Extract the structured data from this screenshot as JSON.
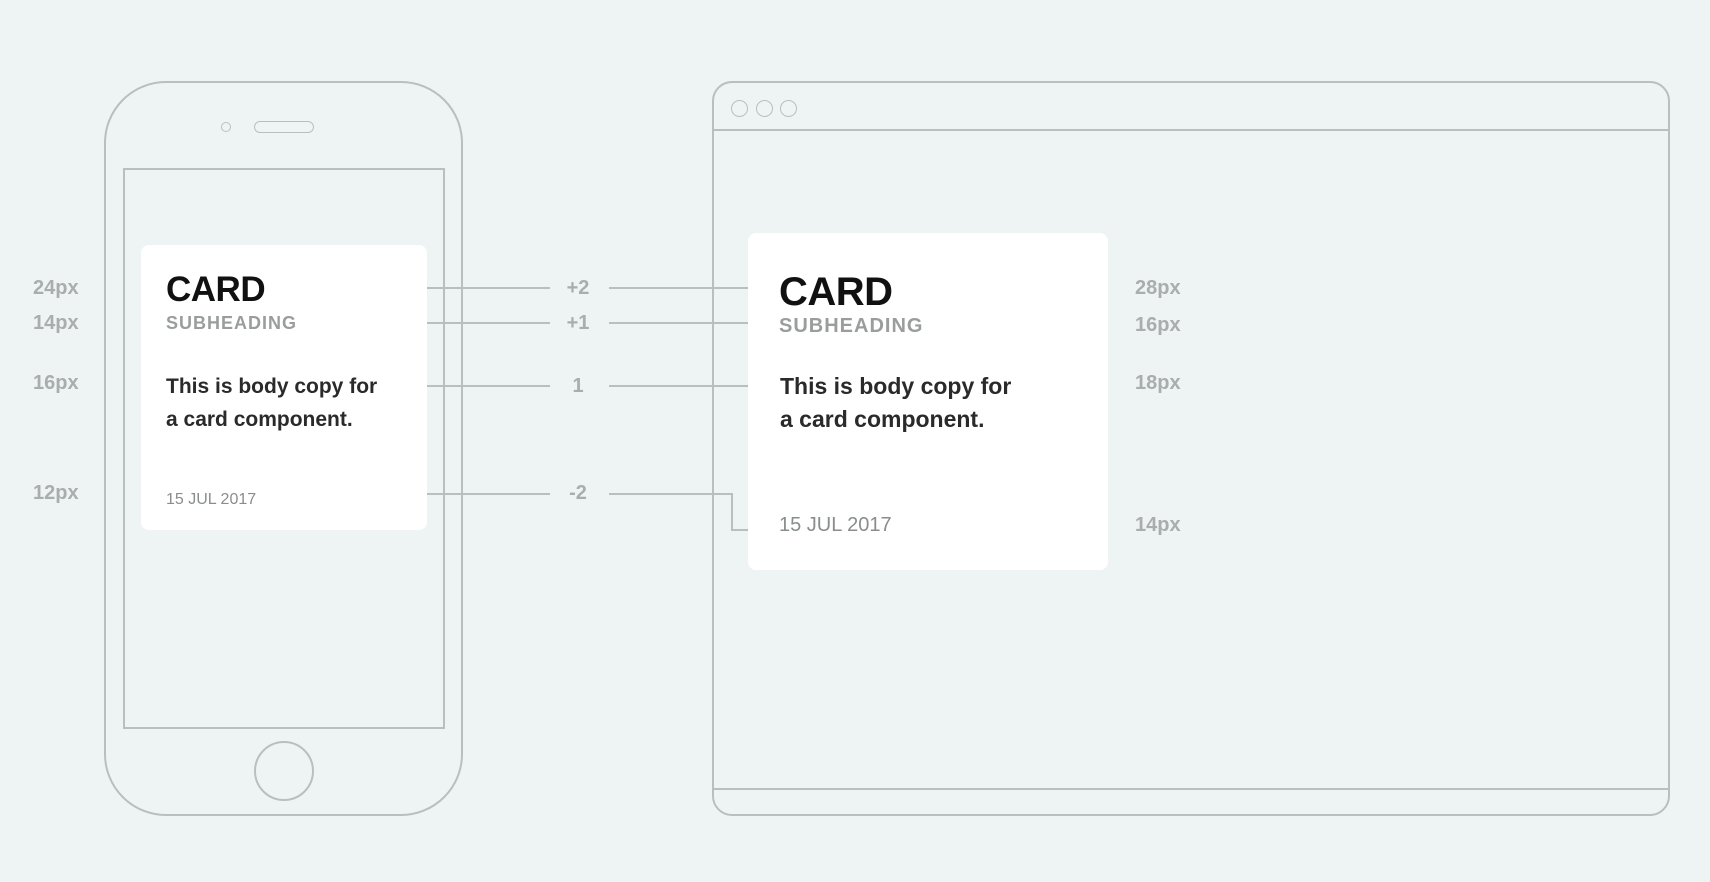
{
  "mobile_card": {
    "title": "CARD",
    "subheading": "SUBHEADING",
    "body_line1": "This is body copy for",
    "body_line2": "a card component.",
    "date": "15 JUL 2017"
  },
  "desktop_card": {
    "title": "CARD",
    "subheading": "SUBHEADING",
    "body_line1": "This is body copy for",
    "body_line2": "a card component.",
    "date": "15 JUL 2017"
  },
  "mobile_sizes": {
    "title": "24px",
    "subheading": "14px",
    "body": "16px",
    "date": "12px"
  },
  "desktop_sizes": {
    "title": "28px",
    "subheading": "16px",
    "body": "18px",
    "date": "14px"
  },
  "scale_steps": {
    "title": "+2",
    "subheading": "+1",
    "body": "1",
    "date": "-2"
  },
  "colors": {
    "background": "#eef4f3",
    "outline": "#b9bfbf",
    "card": "#ffffff",
    "label": "#a9adad"
  }
}
